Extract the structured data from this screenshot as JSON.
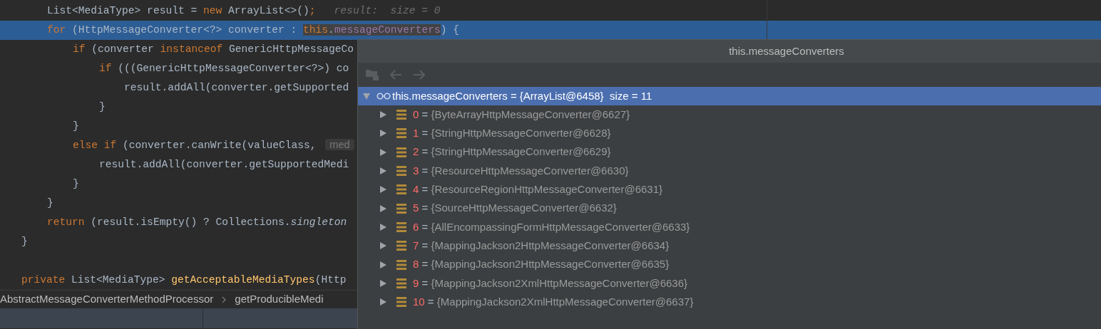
{
  "editor": {
    "lines": [
      {
        "kind": "block",
        "children": [
          {
            "selected": false,
            "tokens": [
              {
                "kind": "plain",
                "text": "List<MediaType> result = "
              },
              {
                "kind": "keyword",
                "text": "new"
              },
              {
                "kind": "plain",
                "text": " ArrayList<>()"
              },
              {
                "kind": "keyword",
                "text": ";"
              },
              {
                "kind": "hint",
                "text": "result:  size = 0"
              }
            ]
          },
          {
            "selected": true,
            "tokens": [
              {
                "kind": "keyword",
                "text": "for"
              },
              {
                "kind": "plain",
                "text": " (HttpMessageConverter<?> converter : "
              },
              {
                "kind": "usage",
                "parts": [
                  {
                    "kind": "keyword",
                    "text": "this"
                  },
                  {
                    "kind": "plain",
                    "text": "."
                  },
                  {
                    "kind": "field",
                    "text": "messageConverters"
                  }
                ]
              },
              {
                "kind": "plain",
                "text": ") {"
              }
            ],
            "children": [
              {
                "selected": false,
                "tokens": [
                  {
                    "kind": "keyword",
                    "text": "if"
                  },
                  {
                    "kind": "plain",
                    "text": " (converter "
                  },
                  {
                    "kind": "keyword",
                    "text": "instanceof"
                  },
                  {
                    "kind": "plain",
                    "text": " GenericHttpMessageCo"
                  }
                ],
                "children": [
                  {
                    "selected": false,
                    "tokens": [
                      {
                        "kind": "keyword",
                        "text": "if"
                      },
                      {
                        "kind": "plain",
                        "text": " (((GenericHttpMessageConverter<?>) co"
                      }
                    ],
                    "children": [
                      {
                        "selected": false,
                        "tokens": [
                          {
                            "kind": "plain",
                            "text": "result.addAll(converter.getSupported"
                          }
                        ]
                      }
                    ]
                  },
                  {
                    "selected": false,
                    "tokens": [
                      {
                        "kind": "plain",
                        "text": "}"
                      }
                    ]
                  }
                ]
              },
              {
                "selected": false,
                "tokens": [
                  {
                    "kind": "plain",
                    "text": "}"
                  }
                ]
              },
              {
                "selected": false,
                "tokens": [
                  {
                    "kind": "keyword",
                    "text": "else if"
                  },
                  {
                    "kind": "plain",
                    "text": " (converter.canWrite(valueClass, "
                  },
                  {
                    "kind": "param_hint",
                    "text": "med"
                  }
                ],
                "children": [
                  {
                    "selected": false,
                    "tokens": [
                      {
                        "kind": "plain",
                        "text": "result.addAll(converter.getSupportedMedi"
                      }
                    ]
                  }
                ]
              },
              {
                "selected": false,
                "tokens": [
                  {
                    "kind": "plain",
                    "text": "}"
                  }
                ]
              }
            ]
          },
          {
            "selected": false,
            "tokens": [
              {
                "kind": "plain",
                "text": "}"
              }
            ]
          },
          {
            "selected": false,
            "tokens": [
              {
                "kind": "keyword",
                "text": "return"
              },
              {
                "kind": "plain",
                "text": " (result.isEmpty() ? Collections."
              },
              {
                "kind": "static",
                "text": "singleton"
              }
            ]
          }
        ]
      },
      {
        "selected": false,
        "tokens": [
          {
            "kind": "plain",
            "text": "}"
          }
        ]
      },
      {
        "kind": "blank",
        "selected": false
      },
      {
        "selected": false,
        "tokens": [
          {
            "kind": "keyword",
            "text": "private"
          },
          {
            "kind": "plain",
            "text": " List<MediaType> "
          },
          {
            "kind": "method",
            "text": "getAcceptableMediaTypes"
          },
          {
            "kind": "plain",
            "text": "(Http"
          }
        ]
      }
    ]
  },
  "breadcrumbs": [
    "AbstractMessageConverterMethodProcessor",
    "getProducibleMedi"
  ],
  "popup": {
    "title": "this.messageConverters",
    "toolbar": [
      {
        "kind": "jump",
        "disabled": true
      },
      {
        "kind": "back",
        "disabled": true
      },
      {
        "kind": "forward",
        "disabled": true
      }
    ],
    "tree": {
      "name": "this.messageConverters",
      "sep": "=",
      "value": "{ArrayList@6458}",
      "extra": "size = 11",
      "expanded": true,
      "selected": true,
      "children": [
        {
          "name": "0",
          "sep": "=",
          "value": "{ByteArrayHttpMessageConverter@6627}",
          "expanded": false,
          "selected": false
        },
        {
          "name": "1",
          "sep": "=",
          "value": "{StringHttpMessageConverter@6628}",
          "expanded": false,
          "selected": false
        },
        {
          "name": "2",
          "sep": "=",
          "value": "{StringHttpMessageConverter@6629}",
          "expanded": false,
          "selected": false
        },
        {
          "name": "3",
          "sep": "=",
          "value": "{ResourceHttpMessageConverter@6630}",
          "expanded": false,
          "selected": false
        },
        {
          "name": "4",
          "sep": "=",
          "value": "{ResourceRegionHttpMessageConverter@6631}",
          "expanded": false,
          "selected": false
        },
        {
          "name": "5",
          "sep": "=",
          "value": "{SourceHttpMessageConverter@6632}",
          "expanded": false,
          "selected": false
        },
        {
          "name": "6",
          "sep": "=",
          "value": "{AllEncompassingFormHttpMessageConverter@6633}",
          "expanded": false,
          "selected": false
        },
        {
          "name": "7",
          "sep": "=",
          "value": "{MappingJackson2HttpMessageConverter@6634}",
          "expanded": false,
          "selected": false
        },
        {
          "name": "8",
          "sep": "=",
          "value": "{MappingJackson2HttpMessageConverter@6635}",
          "expanded": false,
          "selected": false
        },
        {
          "name": "9",
          "sep": "=",
          "value": "{MappingJackson2XmlHttpMessageConverter@6636}",
          "expanded": false,
          "selected": false
        },
        {
          "name": "10",
          "sep": "=",
          "value": "{MappingJackson2XmlHttpMessageConverter@6637}",
          "expanded": false,
          "selected": false
        }
      ]
    }
  }
}
